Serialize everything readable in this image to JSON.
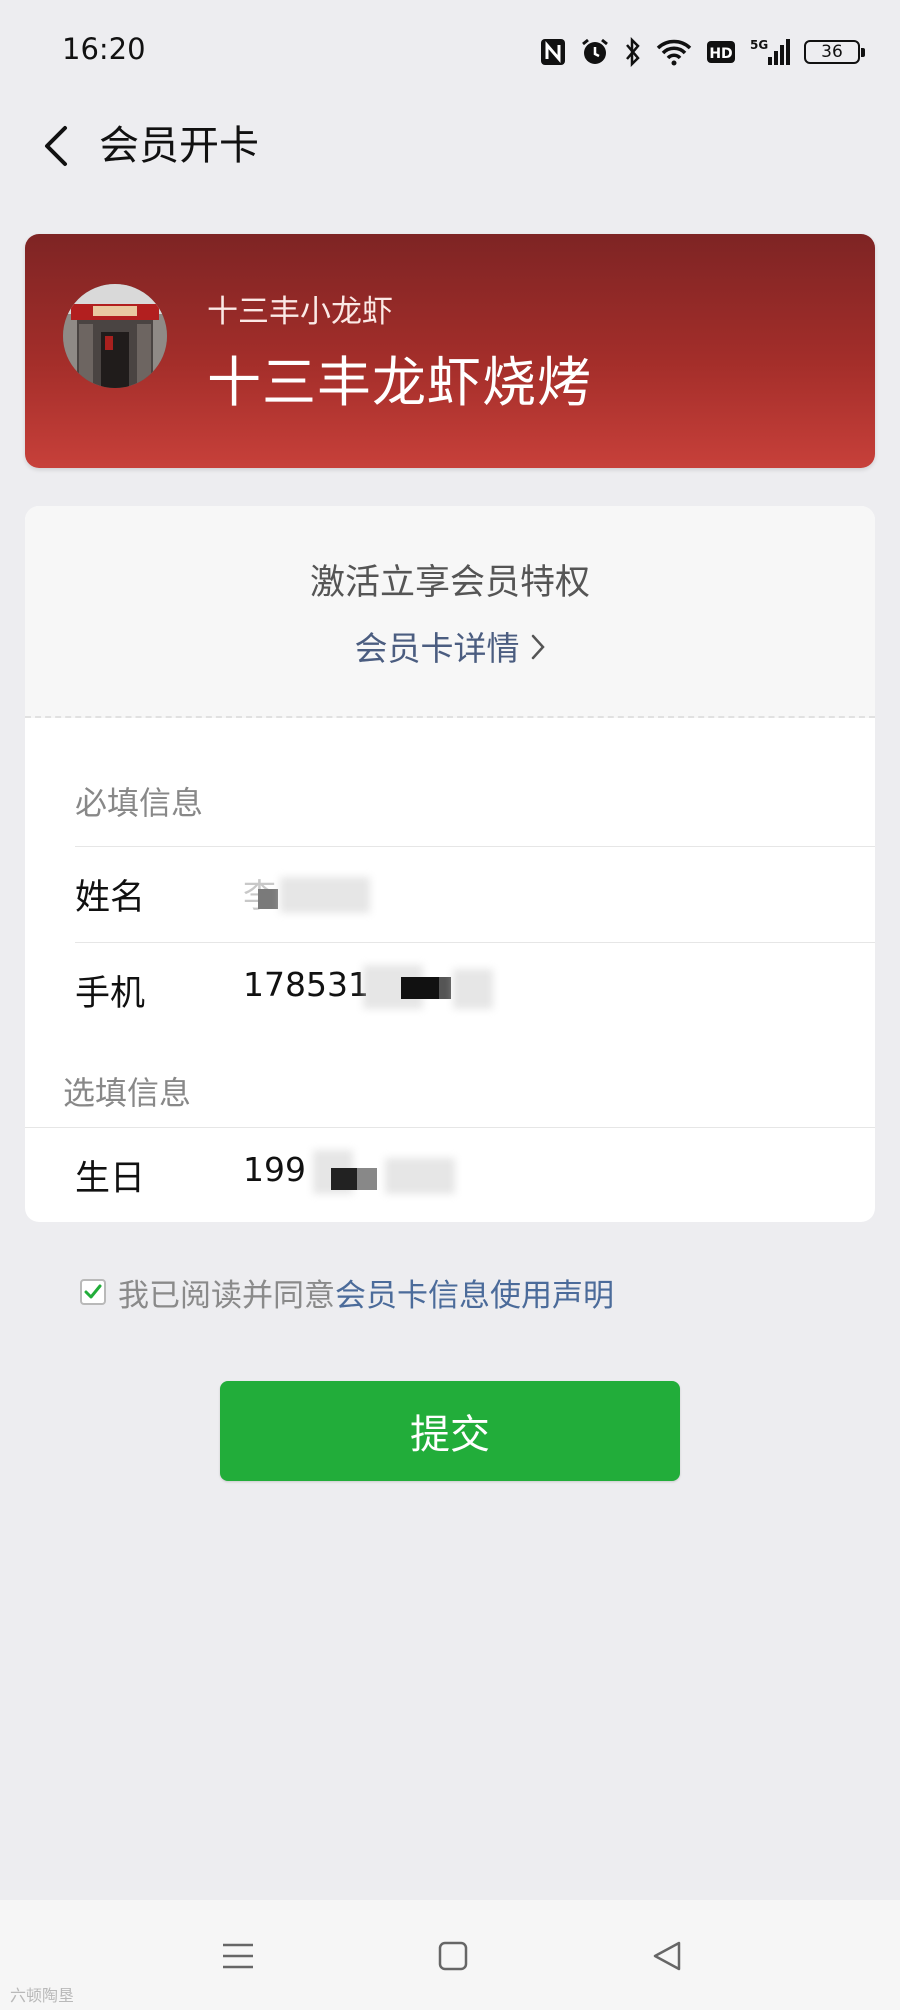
{
  "status_bar": {
    "time": "16:20",
    "icons": [
      "nfc-icon",
      "alarm-icon",
      "bluetooth-icon",
      "wifi-icon",
      "hd-icon",
      "5g-signal-icon"
    ],
    "hd_label": "HD",
    "network_label": "5G",
    "battery": "36"
  },
  "header": {
    "title": "会员开卡",
    "back_icon": "chevron-left-icon"
  },
  "store": {
    "subtitle": "十三丰小龙虾",
    "name": "十三丰龙虾烧烤"
  },
  "card": {
    "privilege_text": "激活立享会员特权",
    "details_link": "会员卡详情"
  },
  "form": {
    "required_label": "必填信息",
    "optional_label": "选填信息",
    "fields": [
      {
        "label": "姓名",
        "value": "李"
      },
      {
        "label": "手机",
        "value": "178531"
      },
      {
        "label": "生日",
        "value": "199"
      }
    ]
  },
  "agreement": {
    "checked": true,
    "text": "我已阅读并同意",
    "link": "会员卡信息使用声明"
  },
  "submit": {
    "label": "提交"
  },
  "navbar": {
    "icons": [
      "menu-icon",
      "home-square-icon",
      "back-triangle-icon"
    ]
  },
  "watermark": "六顿陶垦",
  "colors": {
    "brand_red": "#a42e2a",
    "primary_green": "#22ad3a",
    "link_blue": "#4b6b9a"
  }
}
